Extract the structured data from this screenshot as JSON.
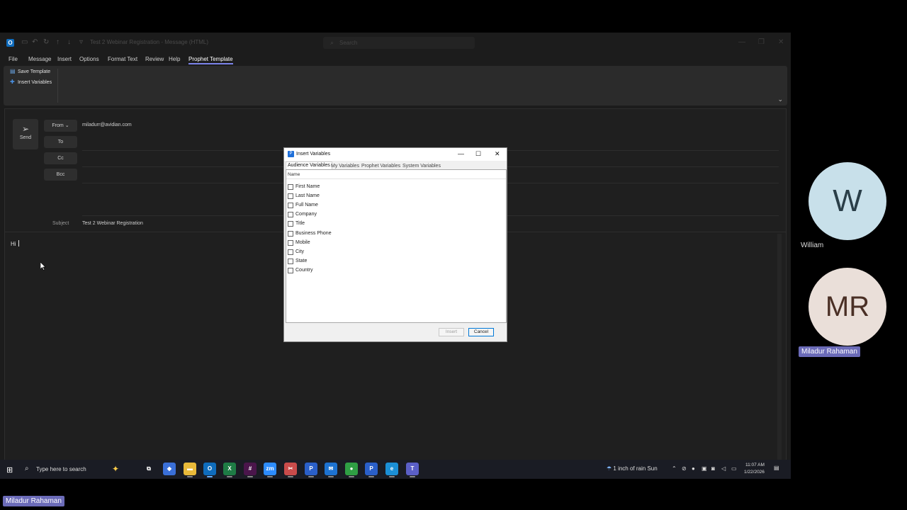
{
  "window": {
    "app_icon": "O",
    "title": "Test 2 Webinar Registration  -  Message (HTML)",
    "search_placeholder": "Search"
  },
  "menu": {
    "items": [
      "File",
      "Message",
      "Insert",
      "Options",
      "Format Text",
      "Review",
      "Help",
      "Prophet Template"
    ],
    "active": "Prophet Template"
  },
  "ribbon": {
    "save_template": "Save Template",
    "insert_variables": "Insert Variables"
  },
  "compose": {
    "send_label": "Send",
    "from_label": "From",
    "from_value": "miladurr@avidian.com",
    "to_label": "To",
    "cc_label": "Cc",
    "bcc_label": "Bcc",
    "subject_label": "Subject",
    "subject_value": "Test 2 Webinar Registration",
    "body_text": "Hi"
  },
  "dialog": {
    "title": "Insert Variables",
    "tabs": [
      "Audience Variables",
      "My Variables",
      "Prophet Variables",
      "System Variables"
    ],
    "active_tab": "Audience Variables",
    "column_header": "Name",
    "rows": [
      {
        "label": "First Name",
        "checked": false
      },
      {
        "label": "Last Name",
        "checked": false
      },
      {
        "label": "Full Name",
        "checked": false
      },
      {
        "label": "Company",
        "checked": false
      },
      {
        "label": "Title",
        "checked": false
      },
      {
        "label": "Business Phone",
        "checked": false
      },
      {
        "label": "Mobile",
        "checked": false
      },
      {
        "label": "City",
        "checked": false
      },
      {
        "label": "State",
        "checked": false
      },
      {
        "label": "Country",
        "checked": false
      }
    ],
    "insert_label": "Insert",
    "cancel_label": "Cancel"
  },
  "taskbar": {
    "search_placeholder": "Type here to search",
    "apps": [
      {
        "name": "task-view",
        "glyph": "⧉",
        "color": "#1a1c24"
      },
      {
        "name": "copilot",
        "glyph": "◆",
        "color": "#3a6fd8"
      },
      {
        "name": "file-explorer",
        "glyph": "▬",
        "color": "#e8b93a"
      },
      {
        "name": "outlook",
        "glyph": "O",
        "color": "#0f6cbd"
      },
      {
        "name": "excel",
        "glyph": "X",
        "color": "#1e7b45"
      },
      {
        "name": "slack",
        "glyph": "#",
        "color": "#4a154b"
      },
      {
        "name": "zoom",
        "glyph": "zm",
        "color": "#2d8cff"
      },
      {
        "name": "snipping-tool",
        "glyph": "✂",
        "color": "#c94b4b"
      },
      {
        "name": "prophet-app",
        "glyph": "P",
        "color": "#2a5fc9"
      },
      {
        "name": "outlook-new",
        "glyph": "✉",
        "color": "#1d72d2"
      },
      {
        "name": "chrome",
        "glyph": "●",
        "color": "#2f9e44"
      },
      {
        "name": "prophet-app-2",
        "glyph": "P",
        "color": "#2a5fc9"
      },
      {
        "name": "edge",
        "glyph": "e",
        "color": "#1b8fd6"
      },
      {
        "name": "teams",
        "glyph": "T",
        "color": "#5b5fc7"
      }
    ],
    "weather": "1 inch of rain Sun",
    "time": "11:07 AM",
    "date": "1/22/2026"
  },
  "participants": {
    "william_initial": "W",
    "william_name": "William",
    "miladur_initials": "MR",
    "miladur_name": "Miladur Rahaman"
  },
  "self_label": "Miladur Rahaman"
}
